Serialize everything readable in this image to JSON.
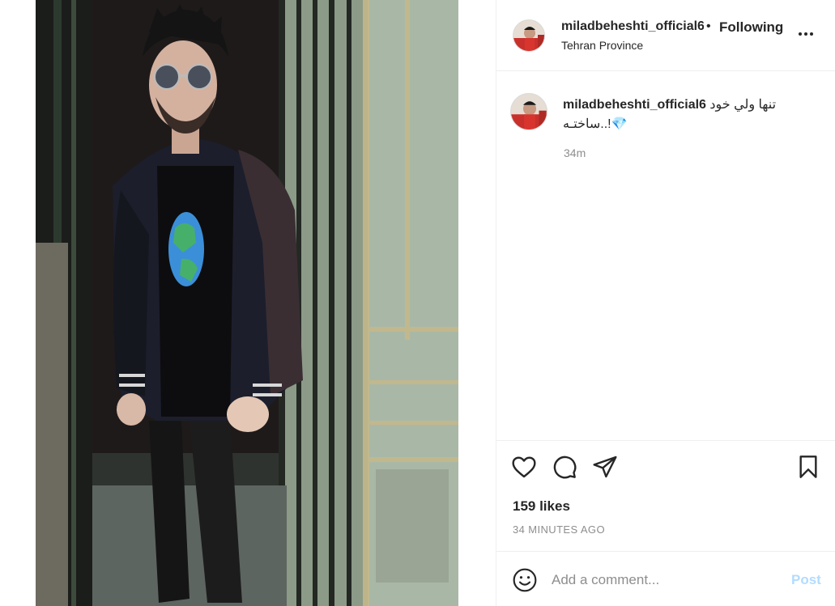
{
  "post": {
    "author": {
      "username": "miladbeheshti_official6",
      "location": "Tehran Province",
      "follow_status": "Following",
      "separator": "•"
    },
    "caption": {
      "username": "miladbeheshti_official6",
      "text": "تنها ولي خود ساختـه..!💎",
      "time_ago": "34m"
    },
    "likes_text": "159 likes",
    "posted_ago": "34 MINUTES AGO",
    "comment_box": {
      "placeholder": "Add a comment...",
      "post_label": "Post"
    },
    "icons": {
      "more": "more-options-icon",
      "like": "heart-icon",
      "comment": "comment-bubble-icon",
      "share": "paper-plane-icon",
      "save": "bookmark-icon",
      "emoji": "emoji-smile-icon"
    },
    "colors": {
      "text": "#262626",
      "muted": "#8e8e8e",
      "post_disabled": "#b3dbff",
      "divider": "#efefef"
    }
  }
}
